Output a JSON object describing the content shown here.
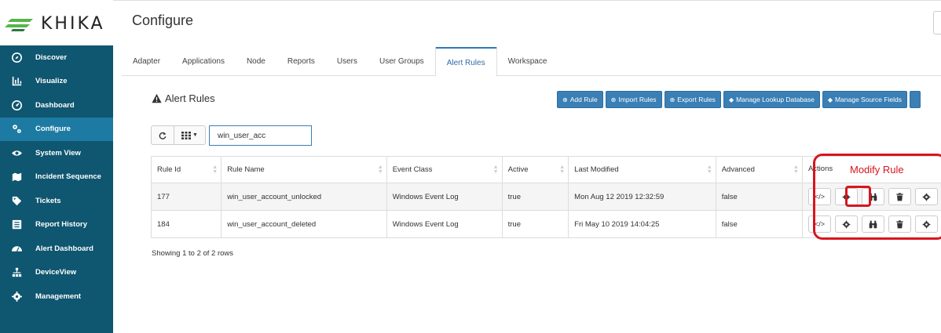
{
  "app": {
    "logo_text": "KHIKA",
    "page_title": "Configure"
  },
  "sidebar": {
    "items": [
      {
        "label": "Discover",
        "icon": "compass-icon"
      },
      {
        "label": "Visualize",
        "icon": "bar-chart-icon"
      },
      {
        "label": "Dashboard",
        "icon": "dashboard-icon"
      },
      {
        "label": "Configure",
        "icon": "gears-icon",
        "active": true
      },
      {
        "label": "System View",
        "icon": "eye-icon"
      },
      {
        "label": "Incident Sequence",
        "icon": "map-icon"
      },
      {
        "label": "Tickets",
        "icon": "tag-icon"
      },
      {
        "label": "Report History",
        "icon": "list-icon"
      },
      {
        "label": "Alert Dashboard",
        "icon": "tachometer-icon"
      },
      {
        "label": "DeviceView",
        "icon": "sitemap-icon"
      },
      {
        "label": "Management",
        "icon": "gear-icon"
      }
    ]
  },
  "tabs": [
    "Adapter",
    "Applications",
    "Node",
    "Reports",
    "Users",
    "User Groups",
    "Alert Rules",
    "Workspace"
  ],
  "active_tab": "Alert Rules",
  "section": {
    "title": "Alert Rules",
    "buttons": {
      "add": "Add Rule",
      "import": "Import Rules",
      "export": "Export Rules",
      "lookup": "Manage Lookup Database",
      "source": "Manage Source Fields"
    }
  },
  "search": {
    "value": "win_user_acc"
  },
  "table": {
    "headers": [
      "Rule Id",
      "Rule Name",
      "Event Class",
      "Active",
      "Last Modified",
      "Advanced",
      "Actions"
    ],
    "rows": [
      [
        "177",
        "win_user_account_unlocked",
        "Windows Event Log",
        "true",
        "Mon Aug 12 2019 12:32:59",
        "false"
      ],
      [
        "184",
        "win_user_account_deleted",
        "Windows Event Log",
        "true",
        "Fri May 10 2019 14:04:25",
        "false"
      ]
    ]
  },
  "footer": {
    "showing": "Showing 1 to 2 of 2 rows"
  },
  "annotation": {
    "label": "Modify Rule",
    "color": "#d7161f"
  },
  "colors": {
    "sidebar": "#0f5670",
    "sidebar_active": "#1d7ba3",
    "button": "#3a7fb5"
  }
}
